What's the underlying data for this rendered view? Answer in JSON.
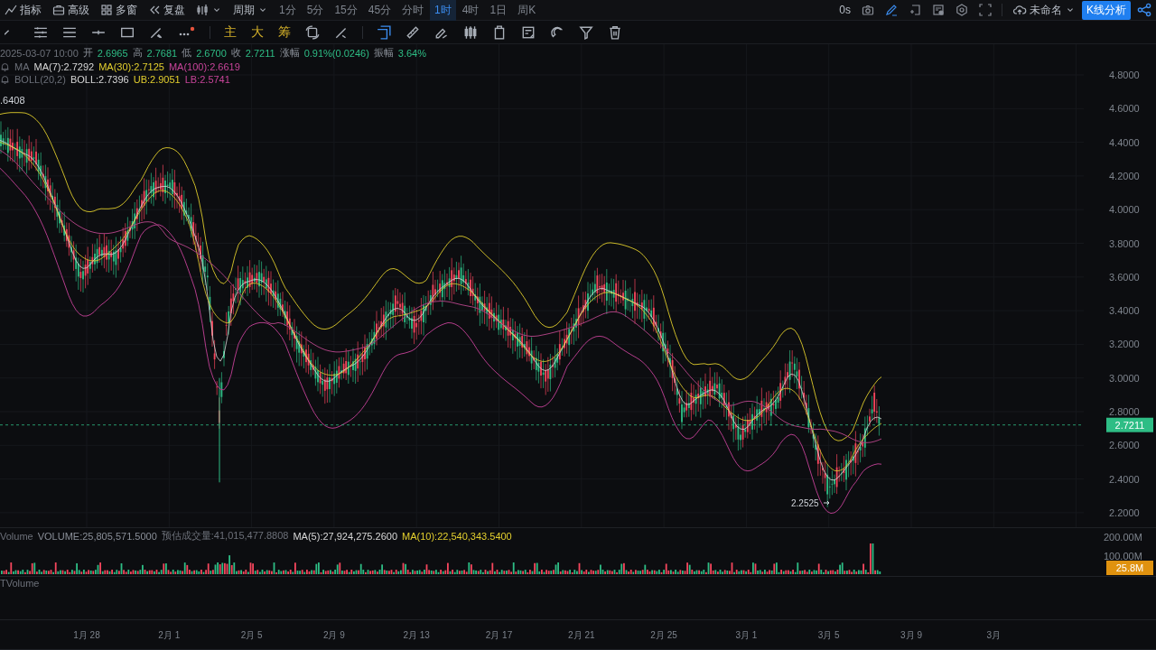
{
  "top_bar": {
    "left": [
      {
        "kind": "indicator",
        "label": "指标"
      },
      {
        "kind": "advanced",
        "label": "高级"
      },
      {
        "kind": "multi",
        "label": "多窗"
      },
      {
        "kind": "replay",
        "label": "复盘"
      },
      {
        "kind": "chart-type"
      },
      {
        "kind": "period",
        "label": "周期"
      }
    ],
    "intervals": [
      {
        "label": "1分",
        "selected": false
      },
      {
        "label": "5分",
        "selected": false
      },
      {
        "label": "15分",
        "selected": false
      },
      {
        "label": "45分",
        "selected": false
      },
      {
        "label": "分时",
        "selected": false
      },
      {
        "label": "1时",
        "selected": true
      },
      {
        "label": "4时",
        "selected": false
      },
      {
        "label": "1日",
        "selected": false
      },
      {
        "label": "周K",
        "selected": false
      }
    ],
    "timer": "0s",
    "layout_name": "未命名",
    "analysis_button": "K线分析"
  },
  "drawing_toolbar": {
    "text_tools": [
      {
        "label": "主"
      },
      {
        "label": "大"
      },
      {
        "label": "筹"
      }
    ]
  },
  "legend": {
    "datetime": "2025-03-07 10:00",
    "ohlc": [
      {
        "label": "开",
        "value": "2.6965"
      },
      {
        "label": "高",
        "value": "2.7681"
      },
      {
        "label": "低",
        "value": "2.6700"
      },
      {
        "label": "收",
        "value": "2.7211"
      },
      {
        "label": "涨幅",
        "value": "0.91%(0.0246)"
      },
      {
        "label": "振幅",
        "value": "3.64%"
      }
    ],
    "indicators": [
      {
        "name": "MA",
        "values": [
          {
            "text": "MA(7):2.7292",
            "color": "#d8d8d8"
          },
          {
            "text": "MA(30):2.7125",
            "color": "#e3cf2e"
          },
          {
            "text": "MA(100):2.6619",
            "color": "#c8449a"
          }
        ]
      },
      {
        "name": "BOLL(20,2)",
        "values": [
          {
            "text": "BOLL:2.7396",
            "color": "#d8d8d8"
          },
          {
            "text": "UB:2.9051",
            "color": "#e3cf2e"
          },
          {
            "text": "LB:2.5741",
            "color": "#c8449a"
          }
        ]
      }
    ]
  },
  "price_chart": {
    "high_label": ".6408",
    "low_label": "2.2525",
    "y_axis": [
      "4.8000",
      "4.6000",
      "4.4000",
      "4.2000",
      "4.0000",
      "3.8000",
      "3.6000",
      "3.4000",
      "3.2000",
      "3.0000",
      "2.8000",
      "2.6000",
      "2.4000",
      "2.2000"
    ],
    "last_price": "2.7211"
  },
  "volume_panel": {
    "name": "Volume",
    "values": [
      {
        "text": "VOLUME:25,805,571.5000",
        "color": "#8a8f98"
      },
      {
        "text": "预估成交量:41,015,477.8808",
        "color": "#6c7079"
      },
      {
        "text": "MA(5):27,924,275.2600",
        "color": "#d8d8d8"
      },
      {
        "text": "MA(10):22,540,343.5400",
        "color": "#e3cf2e"
      }
    ],
    "y_axis": [
      "200.00M",
      "100.00M"
    ],
    "last_volume": "25.8M"
  },
  "tvolume_panel": {
    "name": "TVolume"
  },
  "x_axis": [
    "1月 28",
    "2月 1",
    "2月 5",
    "2月 9",
    "2月 13",
    "2月 17",
    "2月 21",
    "2月 25",
    "3月 1",
    "3月 5",
    "3月 9",
    "3月"
  ]
}
